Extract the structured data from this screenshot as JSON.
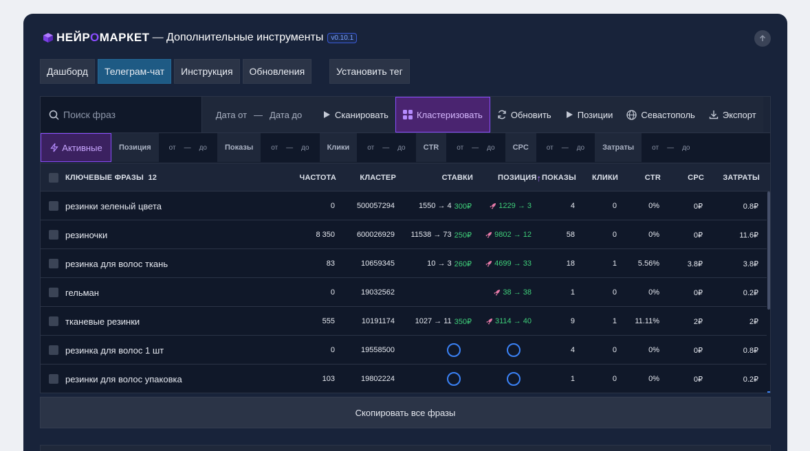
{
  "header": {
    "brand_pre": "НЕЙР",
    "brand_o": "О",
    "brand_post": "МАРКЕТ",
    "title": "— Дополнительные инструменты",
    "version": "v0.10.1"
  },
  "nav": {
    "items": [
      "Дашборд",
      "Телеграм-чат",
      "Инструкция",
      "Обновления"
    ],
    "active": "Телеграм-чат",
    "tag_button": "Установить тег"
  },
  "toolbar": {
    "search_placeholder": "Поиск фраз",
    "date_from": "Дата от",
    "date_dash": "—",
    "date_to": "Дата до",
    "scan": "Сканировать",
    "cluster": "Кластеризовать",
    "refresh": "Обновить",
    "positions": "Позиции",
    "region": "Севастополь",
    "export": "Экспорт"
  },
  "filters": {
    "active": "Активные",
    "from": "от",
    "dash": "—",
    "to": "до",
    "groups": [
      "Позиция",
      "Показы",
      "Клики",
      "CTR",
      "CPC",
      "Затраты"
    ]
  },
  "table": {
    "columns": {
      "phrases": "КЛЮЧЕВЫЕ ФРАЗЫ",
      "count": "12",
      "freq": "ЧАСТОТА",
      "cluster": "КЛАСТЕР",
      "bids": "СТАВКИ",
      "position": "ПОЗИЦИЯ",
      "sort_arrow": "↑",
      "shows": "ПОКАЗЫ",
      "clicks": "КЛИКИ",
      "ctr": "CTR",
      "cpc": "CPC",
      "cost": "ЗАТРАТЫ"
    },
    "rows": [
      {
        "phrase": "резинки зеленый цвета",
        "freq": "0",
        "cluster": "500057294",
        "bid": "1550 → 4",
        "bid_price": "300₽",
        "position": "1229 → 3",
        "shows": "4",
        "clicks": "0",
        "ctr": "0%",
        "cpc": "0₽",
        "cost": "0.8₽"
      },
      {
        "phrase": "резиночки",
        "freq": "8 350",
        "cluster": "600026929",
        "bid": "11538 → 73",
        "bid_price": "250₽",
        "position": "9802 → 12",
        "shows": "58",
        "clicks": "0",
        "ctr": "0%",
        "cpc": "0₽",
        "cost": "11.6₽"
      },
      {
        "phrase": "резинка для волос ткань",
        "freq": "83",
        "cluster": "10659345",
        "bid": "10 → 3",
        "bid_price": "260₽",
        "position": "4699 → 33",
        "shows": "18",
        "clicks": "1",
        "ctr": "5.56%",
        "cpc": "3.8₽",
        "cost": "3.8₽"
      },
      {
        "phrase": "гельман",
        "freq": "0",
        "cluster": "19032562",
        "bid": "",
        "bid_price": "",
        "position": "38 → 38",
        "shows": "1",
        "clicks": "0",
        "ctr": "0%",
        "cpc": "0₽",
        "cost": "0.2₽"
      },
      {
        "phrase": "тканевые резинки",
        "freq": "555",
        "cluster": "10191174",
        "bid": "1027 → 11",
        "bid_price": "350₽",
        "position": "3114 → 40",
        "shows": "9",
        "clicks": "1",
        "ctr": "11.11%",
        "cpc": "2₽",
        "cost": "2₽"
      },
      {
        "phrase": "резинка для волос 1 шт",
        "freq": "0",
        "cluster": "19558500",
        "bid": "",
        "bid_price": "",
        "position": "",
        "loading": true,
        "shows": "4",
        "clicks": "0",
        "ctr": "0%",
        "cpc": "0₽",
        "cost": "0.8₽"
      },
      {
        "phrase": "резинки для волос упаковка",
        "freq": "103",
        "cluster": "19802224",
        "bid": "",
        "bid_price": "",
        "position": "",
        "loading": true,
        "shows": "1",
        "clicks": "0",
        "ctr": "0%",
        "cpc": "0₽",
        "cost": "0.2₽"
      }
    ]
  },
  "copy_all": "Скопировать все фразы",
  "colors": {
    "panel": "#18233a",
    "accent_purple": "#8b4dff",
    "active_tab": "#1e5a84",
    "green": "#3fd07a",
    "spinner_blue": "#3b82f6"
  }
}
